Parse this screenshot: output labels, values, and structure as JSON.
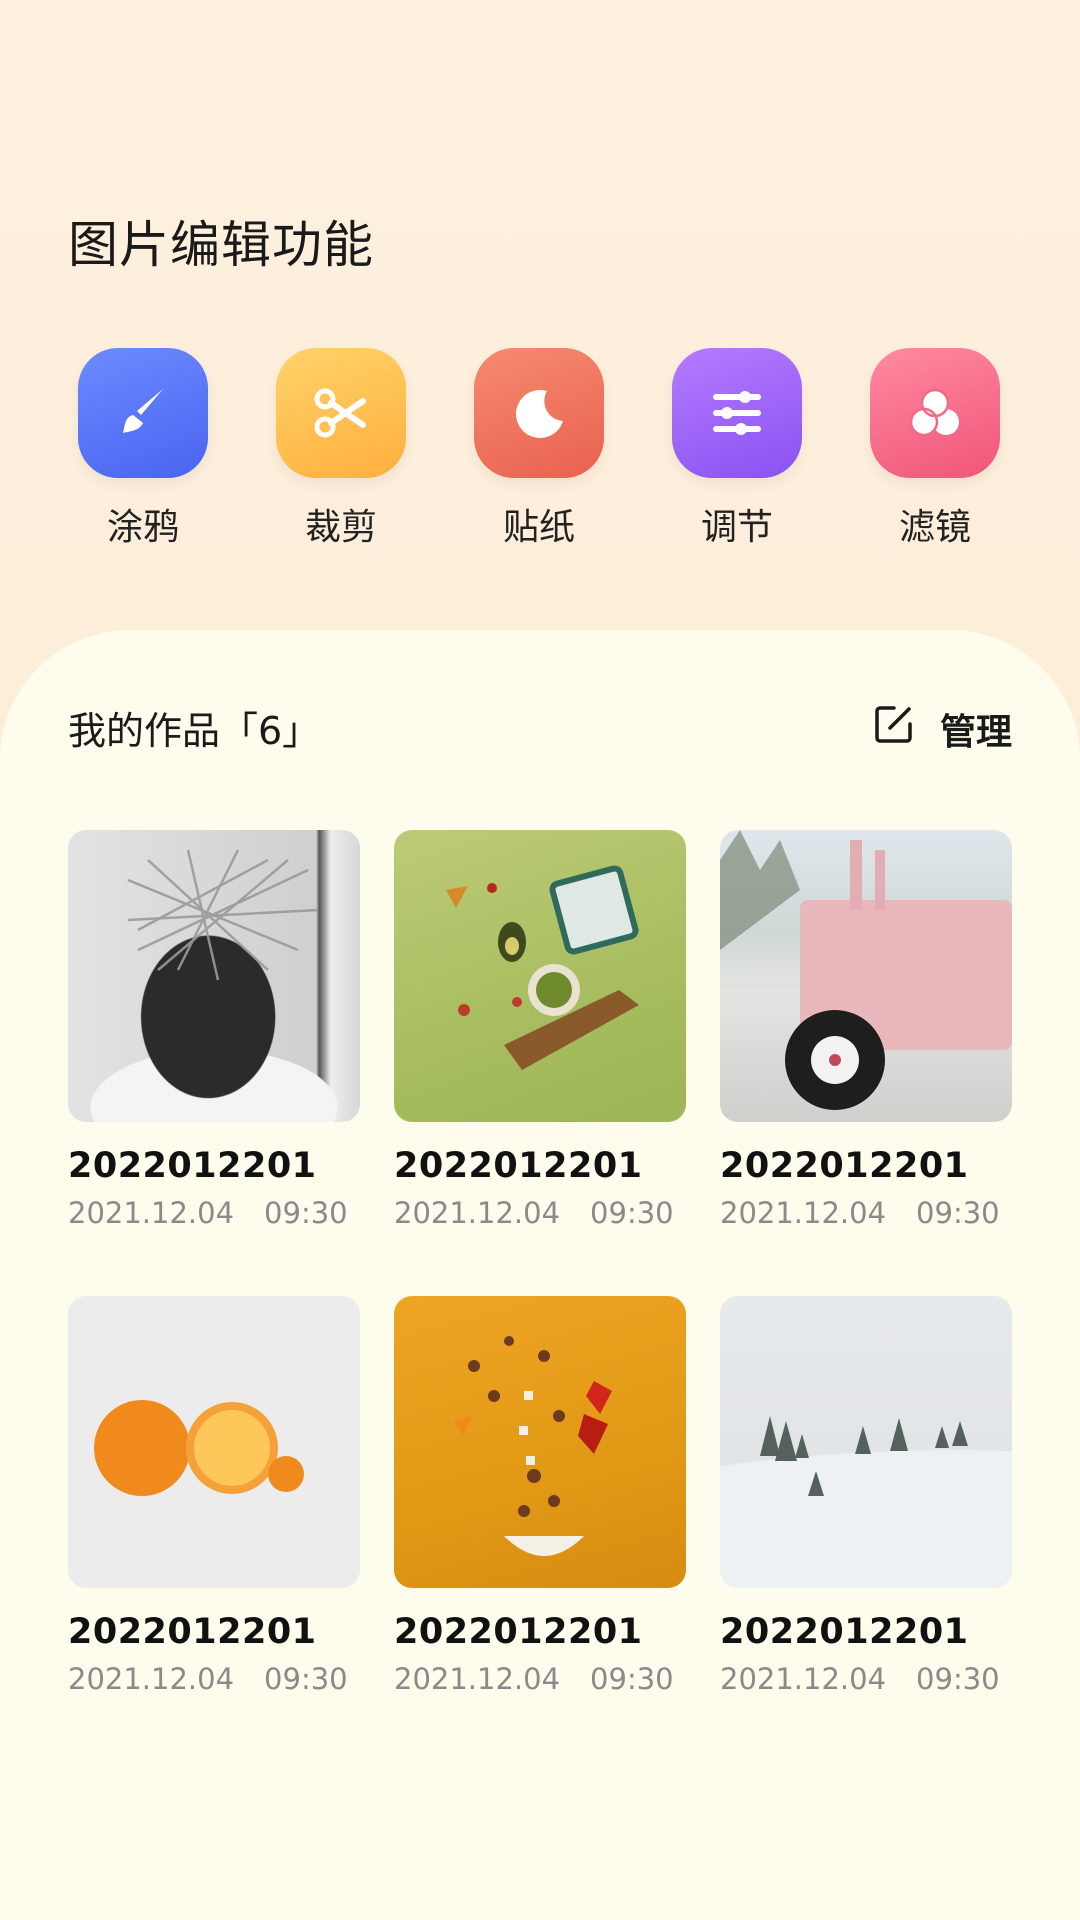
{
  "page_title": "图片编辑功能",
  "tools": [
    {
      "label": "涂鸦",
      "icon": "brush-icon",
      "color_from": "#6c8bff",
      "color_to": "#4a64f0"
    },
    {
      "label": "裁剪",
      "icon": "scissors-icon",
      "color_from": "#ffd36a",
      "color_to": "#ffaf3d"
    },
    {
      "label": "贴纸",
      "icon": "sticker-moon-icon",
      "color_from": "#f58a70",
      "color_to": "#e9624e"
    },
    {
      "label": "调节",
      "icon": "sliders-icon",
      "color_from": "#b57bff",
      "color_to": "#8a52f2"
    },
    {
      "label": "滤镜",
      "icon": "filter-circles-icon",
      "color_from": "#ff8aa0",
      "color_to": "#f0557a"
    }
  ],
  "works": {
    "header": "我的作品「6」",
    "manage_label": "管理",
    "items": [
      {
        "name": "2022012201",
        "date": "2021.12.04",
        "time": "09:30",
        "thumb": "portrait"
      },
      {
        "name": "2022012201",
        "date": "2021.12.04",
        "time": "09:30",
        "thumb": "food-green"
      },
      {
        "name": "2022012201",
        "date": "2021.12.04",
        "time": "09:30",
        "thumb": "tractor"
      },
      {
        "name": "2022012201",
        "date": "2021.12.04",
        "time": "09:30",
        "thumb": "oranges"
      },
      {
        "name": "2022012201",
        "date": "2021.12.04",
        "time": "09:30",
        "thumb": "food-yellow"
      },
      {
        "name": "2022012201",
        "date": "2021.12.04",
        "time": "09:30",
        "thumb": "snow"
      }
    ]
  }
}
